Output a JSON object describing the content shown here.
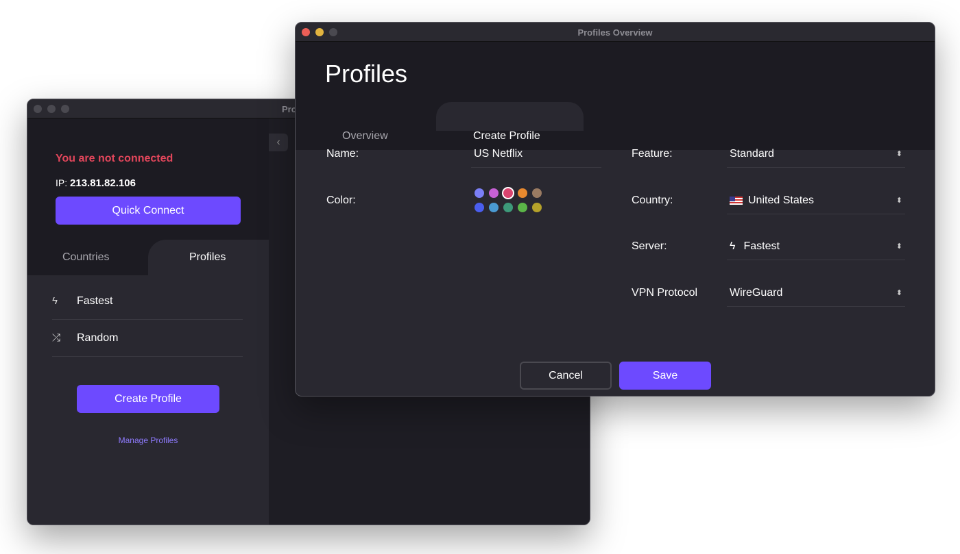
{
  "back_window": {
    "title": "Pro",
    "status": "You are not connected",
    "ip_label": "IP:",
    "ip": "213.81.82.106",
    "quick_connect": "Quick Connect",
    "tabs": [
      "Countries",
      "Profiles"
    ],
    "profiles": [
      {
        "icon": "bolt-icon",
        "label": "Fastest"
      },
      {
        "icon": "shuffle-icon",
        "label": "Random"
      }
    ],
    "create_profile": "Create Profile",
    "manage_profiles": "Manage Profiles"
  },
  "front_window": {
    "title": "Profiles Overview",
    "heading": "Profiles",
    "tabs": [
      "Overview",
      "Create Profile"
    ],
    "active_tab": "Create Profile",
    "name_label": "Name:",
    "name_value": "US Netflix",
    "color_label": "Color:",
    "colors": [
      "#7b7ff6",
      "#c660d4",
      "#d9446f",
      "#e8892f",
      "#9a7b62",
      "#4a5eee",
      "#4a9ad3",
      "#3d9a7a",
      "#5bb548",
      "#b5a22a"
    ],
    "selected_color": "#d9446f",
    "feature_label": "Feature:",
    "feature": "Standard",
    "country_label": "Country:",
    "country": "United States",
    "server_label": "Server:",
    "server": "Fastest",
    "protocol_label": "VPN Protocol",
    "protocol": "WireGuard",
    "cancel": "Cancel",
    "save": "Save"
  },
  "accent": "#6d4aff",
  "error": "#e2465b"
}
